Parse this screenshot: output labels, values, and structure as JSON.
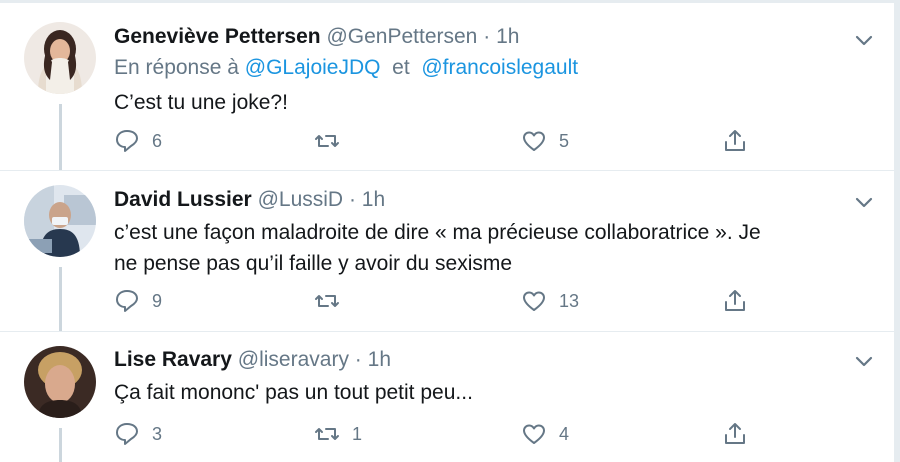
{
  "colors": {
    "accent": "#1b95e0",
    "muted": "#657786",
    "text": "#14171a"
  },
  "tweets": [
    {
      "name": "Geneviève Pettersen",
      "handle": "@GenPettersen",
      "dot": "·",
      "time": "1h",
      "reply_prefix": "En réponse à",
      "mention1": "@GLajoieJDQ",
      "reply_joiner": "et",
      "mention2": "@francoislegault",
      "text": "C’est tu une joke?!",
      "replies": "6",
      "retweets": "",
      "likes": "5"
    },
    {
      "name": "David Lussier",
      "handle": "@LussiD",
      "dot": "·",
      "time": "1h",
      "text_line1": "c’est une façon maladroite de dire « ma précieuse collaboratrice ». Je",
      "text_line2": "ne pense pas qu’il faille y avoir du sexisme",
      "replies": "9",
      "retweets": "",
      "likes": "13"
    },
    {
      "name": "Lise Ravary",
      "handle": "@liseravary",
      "dot": "·",
      "time": "1h",
      "text": "Ça fait mononc' pas un tout petit peu...",
      "replies": "3",
      "retweets": "1",
      "likes": "4"
    }
  ],
  "icons": {
    "reply": "reply-icon",
    "retweet": "retweet-icon",
    "like": "heart-icon",
    "share": "share-icon",
    "more": "chevron-down-icon"
  }
}
